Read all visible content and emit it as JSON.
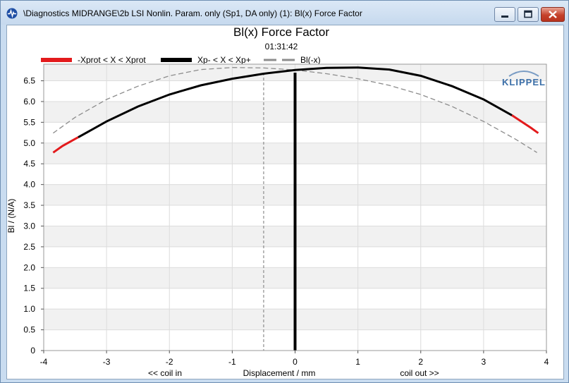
{
  "window": {
    "title": "\\Diagnostics MIDRANGE\\2b LSI Nonlin. Param. only (Sp1, DA only) (1): Bl(x) Force Factor",
    "icon": "diagnostics-pulse-icon",
    "controls": [
      "minimize-icon",
      "maximize-icon",
      "close-icon"
    ]
  },
  "brand": {
    "logo_text": "KLIPPEL",
    "color": "#3b6fa8"
  },
  "chart_data": {
    "type": "line",
    "title": "Bl(x) Force Factor",
    "subtitle": "01:31:42",
    "xlabel": "Displacement / mm",
    "x_hint_left": "<< coil in",
    "x_hint_right": "coil out >>",
    "ylabel": "Bl / (N/A)",
    "xlim": [
      -4,
      4
    ],
    "ylim": [
      0,
      6.9
    ],
    "x_ticks": [
      "-4",
      "-3",
      "-2",
      "-1",
      "0",
      "1",
      "2",
      "3",
      "4"
    ],
    "y_ticks": [
      "0",
      "0.5",
      "1.0",
      "1.5",
      "2.0",
      "2.5",
      "3.0",
      "3.5",
      "4.0",
      "4.5",
      "5.0",
      "5.5",
      "6.0",
      "6.5"
    ],
    "grid": true,
    "legend_position": "top",
    "markers": {
      "xprot_marker": -0.5,
      "xp_marker": 0
    },
    "series": [
      {
        "name": "-Xprot < X < Xprot",
        "color": "#e31a1c",
        "style": "solid",
        "x": [
          -3.85,
          -3.7,
          -3.5,
          -3.45,
          3.45,
          3.6,
          3.75,
          3.87
        ],
        "y": [
          4.77,
          4.93,
          5.1,
          5.14,
          5.67,
          5.52,
          5.37,
          5.24
        ]
      },
      {
        "name": "Xp- < X < Xp+",
        "color": "#000000",
        "style": "solid",
        "x": [
          -3.45,
          -3.0,
          -2.5,
          -2.0,
          -1.5,
          -1.0,
          -0.5,
          0.0,
          0.5,
          1.0,
          1.5,
          2.0,
          2.5,
          3.0,
          3.45
        ],
        "y": [
          5.14,
          5.52,
          5.88,
          6.17,
          6.39,
          6.55,
          6.67,
          6.76,
          6.81,
          6.82,
          6.77,
          6.62,
          6.37,
          6.05,
          5.67
        ]
      },
      {
        "name": "Bl(-x)",
        "color": "#8c8c8c",
        "style": "dashed",
        "x": [
          -3.85,
          -3.5,
          -3.0,
          -2.5,
          -2.0,
          -1.5,
          -1.0,
          -0.5,
          0.0,
          0.5,
          1.0,
          1.5,
          2.0,
          2.5,
          3.0,
          3.5,
          3.85
        ],
        "y": [
          5.24,
          5.62,
          6.05,
          6.37,
          6.62,
          6.77,
          6.82,
          6.81,
          6.76,
          6.67,
          6.55,
          6.39,
          6.17,
          5.88,
          5.52,
          5.1,
          4.77
        ]
      }
    ]
  }
}
